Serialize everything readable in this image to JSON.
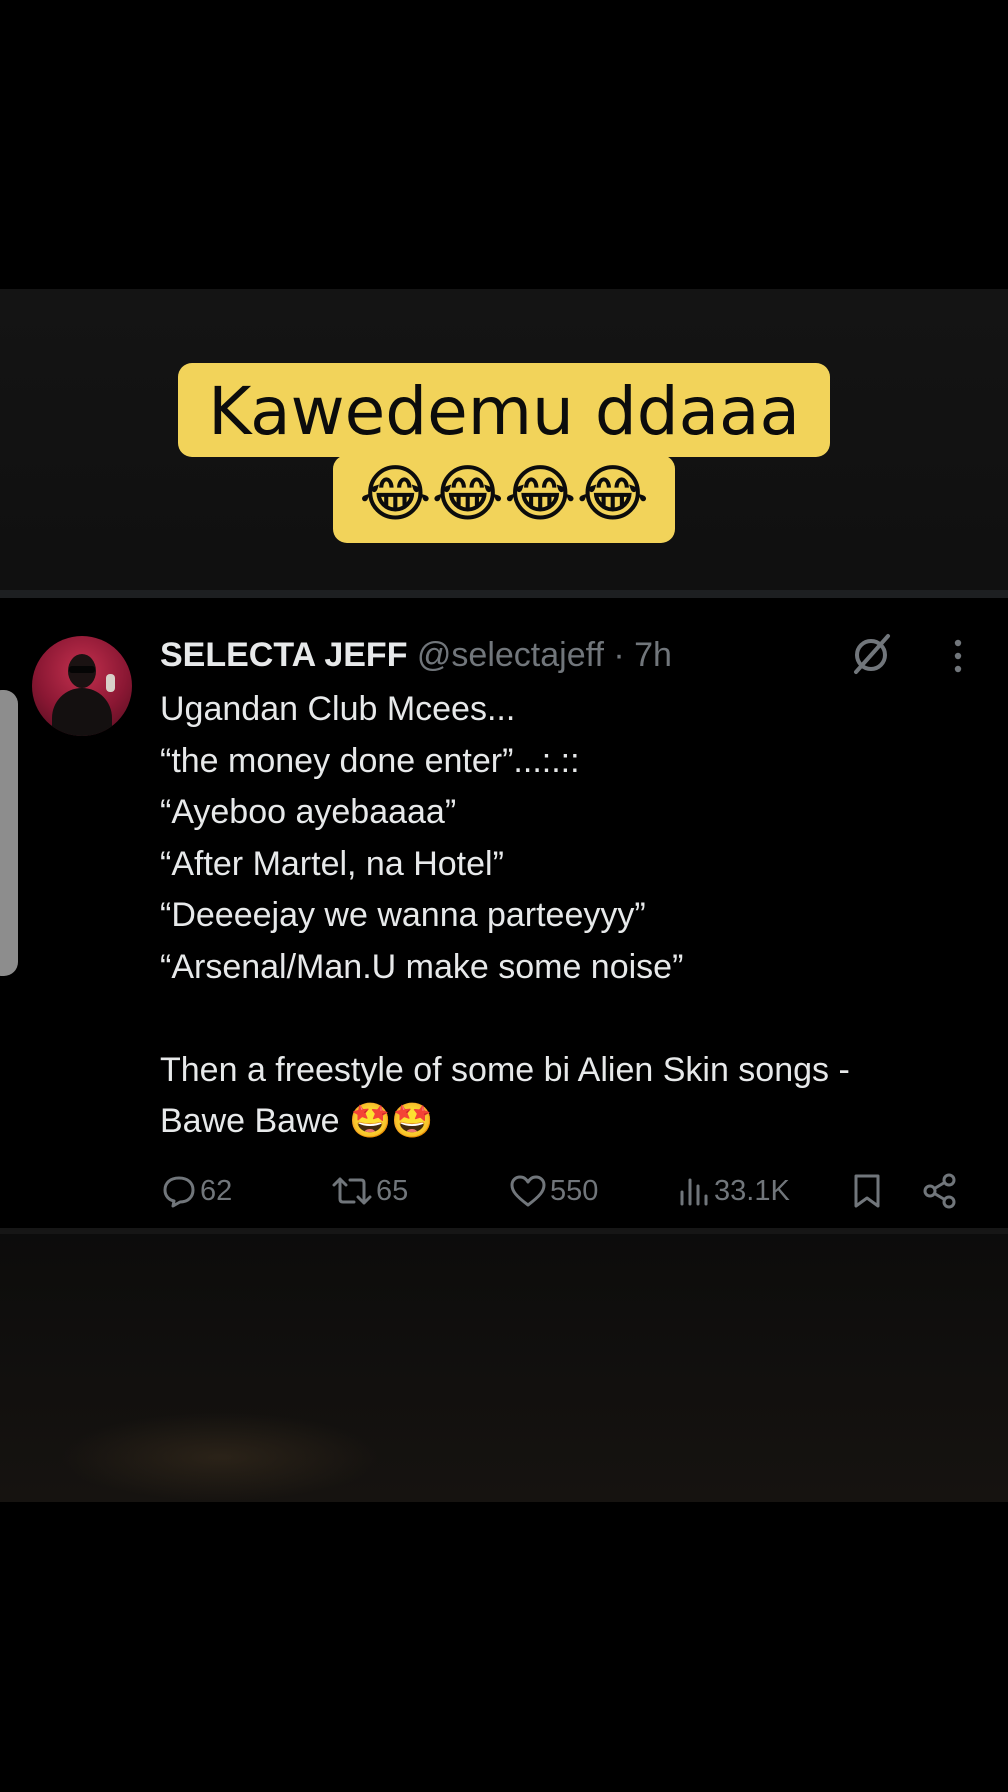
{
  "caption": {
    "line1": "Kawedemu ddaaa",
    "line2": "😂😂😂😂"
  },
  "tweet": {
    "author_name": "SELECTA JEFF",
    "handle": "@selectajeff",
    "separator": "·",
    "time": "7h",
    "lines": [
      "Ugandan Club Mcees...",
      "“the money done enter”...:.::",
      "“Ayeboo ayebaaaa”",
      "“After Martel, na Hotel”",
      "“Deeeejay we wanna parteeyyy”",
      "“Arsenal/Man.U make some noise”",
      "",
      "Then a freestyle of some bi Alien Skin songs -",
      "Bawe Bawe 🤩🤩"
    ],
    "stats": {
      "replies": "62",
      "reposts": "65",
      "likes": "550",
      "views": "33.1K"
    },
    "icons": {
      "avatar": "avatar",
      "grok": "grok-icon",
      "more": "more-icon",
      "reply": "reply-icon",
      "repost": "repost-icon",
      "like": "heart-icon",
      "views": "views-icon",
      "bookmark": "bookmark-icon",
      "share": "share-icon"
    },
    "colors": {
      "text": "#e7e9ea",
      "muted": "#71767b",
      "background": "#000000",
      "caption_bg": "#f2d35a"
    }
  }
}
